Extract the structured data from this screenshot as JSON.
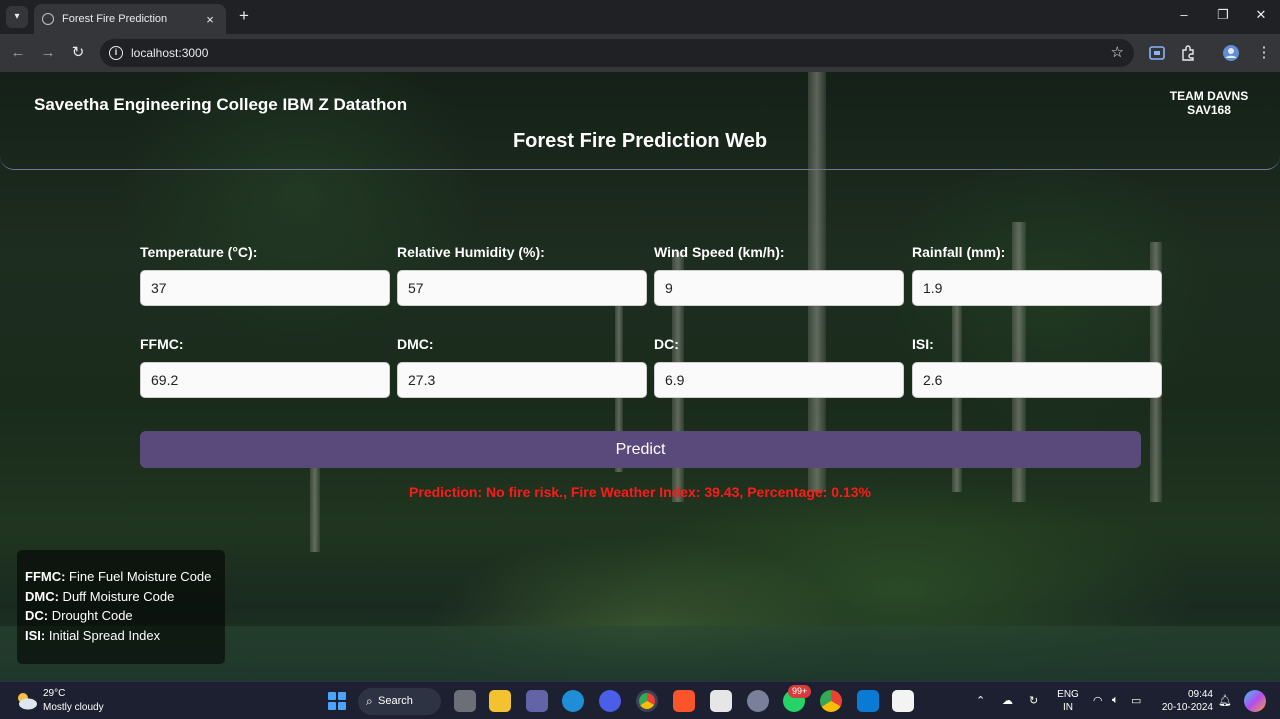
{
  "browser": {
    "tab_title": "Forest Fire Prediction",
    "url": "localhost:3000"
  },
  "header": {
    "college": "Saveetha Engineering College IBM Z Datathon",
    "team_line1": "TEAM DAVNS",
    "team_line2": "SAV168",
    "title": "Forest Fire Prediction Web"
  },
  "form": {
    "fields": [
      {
        "label": "Temperature (°C):",
        "value": "37"
      },
      {
        "label": "Relative Humidity (%):",
        "value": "57"
      },
      {
        "label": "Wind Speed (km/h):",
        "value": "9"
      },
      {
        "label": "Rainfall (mm):",
        "value": "1.9"
      },
      {
        "label": "FFMC:",
        "value": "69.2"
      },
      {
        "label": "DMC:",
        "value": "27.3"
      },
      {
        "label": "DC:",
        "value": "6.9"
      },
      {
        "label": "ISI:",
        "value": "2.6"
      }
    ],
    "predict_label": "Predict",
    "result": "Prediction: No fire risk., Fire Weather Index: 39.43, Percentage: 0.13%"
  },
  "legend": [
    {
      "abbr": "FFMC:",
      "desc": " Fine Fuel Moisture Code"
    },
    {
      "abbr": "DMC:",
      "desc": " Duff Moisture Code"
    },
    {
      "abbr": "DC:",
      "desc": " Drought Code"
    },
    {
      "abbr": "ISI:",
      "desc": " Initial Spread Index"
    }
  ],
  "taskbar": {
    "temperature": "29°C",
    "weather": "Mostly cloudy",
    "search": "Search",
    "badge": "99+",
    "lang_line1": "ENG",
    "lang_line2": "IN",
    "time": "09:44",
    "date": "20-10-2024"
  },
  "colors": {
    "accent": "#5a4a7c",
    "result": "#ff1a1a"
  }
}
